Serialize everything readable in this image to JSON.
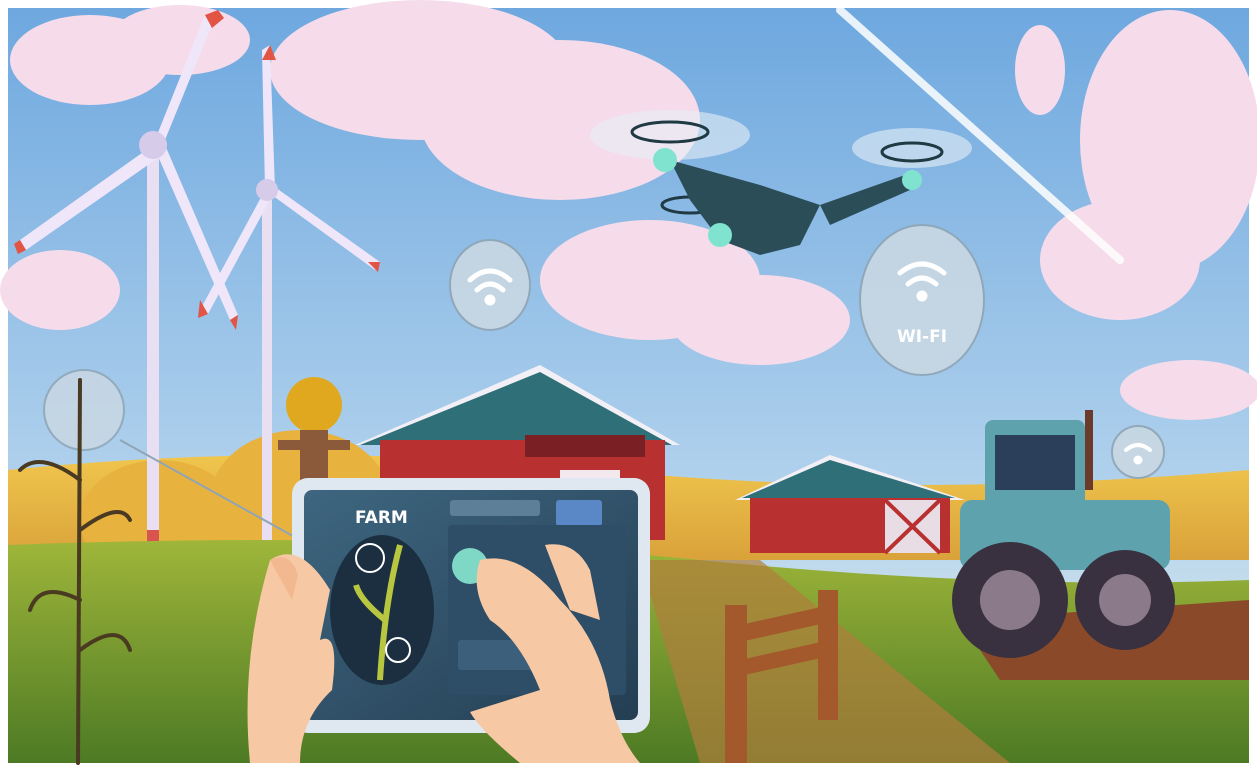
{
  "scene": {
    "tablet": {
      "title": "FARM"
    },
    "wifi_badge": {
      "label": "WI-FI"
    }
  },
  "colors": {
    "sky": "#a9cdeb",
    "cloud": "#f6dcea",
    "barn_red": "#b8302f",
    "roof_teal": "#2f6f78",
    "tractor_blue": "#5ea2ae",
    "field_yellow": "#e6b640",
    "grass": "#6c9a2c",
    "tablet_screen": "#2f4d63"
  }
}
